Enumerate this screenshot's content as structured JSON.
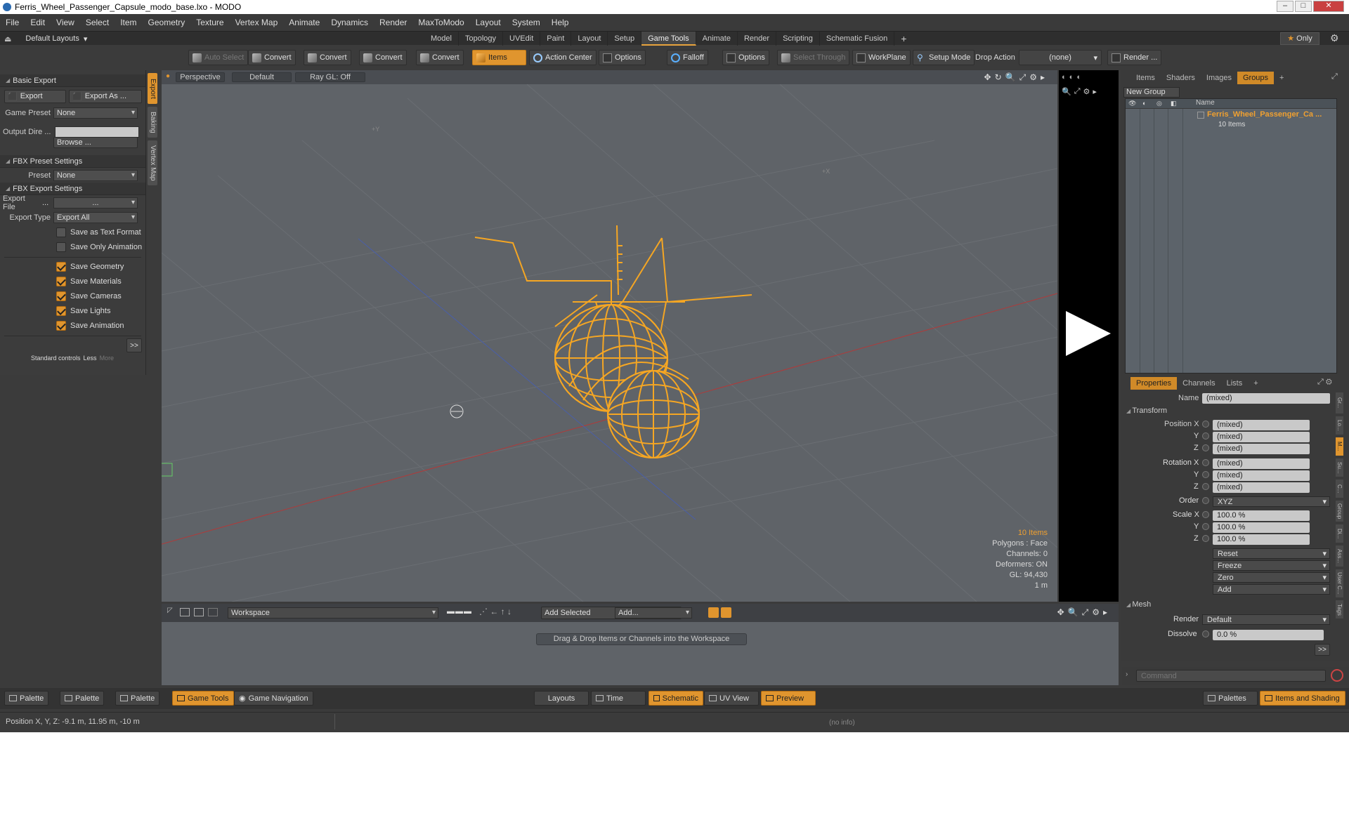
{
  "window": {
    "title": "Ferris_Wheel_Passenger_Capsule_modo_base.lxo - MODO"
  },
  "menu": [
    "File",
    "Edit",
    "View",
    "Select",
    "Item",
    "Geometry",
    "Texture",
    "Vertex Map",
    "Animate",
    "Dynamics",
    "Render",
    "MaxToModo",
    "Layout",
    "System",
    "Help"
  ],
  "layouts": {
    "selector": "Default Layouts",
    "tabs": [
      "Model",
      "Topology",
      "UVEdit",
      "Paint",
      "Layout",
      "Setup",
      "Game Tools",
      "Animate",
      "Render",
      "Scripting",
      "Schematic Fusion"
    ],
    "active_tab": "Game Tools",
    "add": "+",
    "only_label": "Only"
  },
  "toolbar": {
    "auto_select": "Auto Select",
    "convert1": "Convert",
    "convert2": "Convert",
    "convert3": "Convert",
    "convert4": "Convert",
    "items": "Items",
    "action_center": "Action Center",
    "options1": "Options",
    "falloff": "Falloff",
    "options2": "Options",
    "select_through": "Select Through",
    "workplane": "WorkPlane",
    "setup_mode": "Setup Mode",
    "drop_action_label": "Drop Action",
    "drop_action_value": "(none)",
    "render": "Render ..."
  },
  "left_panel": {
    "side_tabs": [
      "Export",
      "Baking",
      "Vertex Map"
    ],
    "basic_export": "Basic Export",
    "export_btn": "Export",
    "export_as_btn": "Export As ...",
    "game_preset_label": "Game Preset",
    "game_preset_value": "None",
    "output_dir_label": "Output Dire ...",
    "output_dir_value": "",
    "browse": "Browse ...",
    "fbx_preset_settings": "FBX Preset Settings",
    "preset_label": "Preset",
    "preset_value": "None",
    "fbx_export_settings": "FBX Export Settings",
    "export_file_label": "Export File",
    "export_file_dots": "...",
    "export_file_value": "...",
    "export_type_label": "Export Type",
    "export_type_value": "Export All",
    "checkboxes": [
      {
        "label": "Save as Text Format",
        "checked": false
      },
      {
        "label": "Save Only Animation",
        "checked": false
      },
      {
        "label": "Save Geometry",
        "checked": true
      },
      {
        "label": "Save Materials",
        "checked": true
      },
      {
        "label": "Save Cameras",
        "checked": true
      },
      {
        "label": "Save Lights",
        "checked": true
      },
      {
        "label": "Save Animation",
        "checked": true
      }
    ],
    "expand": ">>",
    "standard_controls": "Standard controls",
    "less": "Less",
    "more": "More"
  },
  "viewport": {
    "view": "Perspective",
    "shading": "Default",
    "raygl": "Ray GL: Off",
    "axis_y_marker": "+Y",
    "axis_x_marker": "+X",
    "stats": {
      "items": "10 Items",
      "polygons": "Polygons : Face",
      "channels": "Channels: 0",
      "deformers": "Deformers: ON",
      "gl": "GL: 94,430",
      "scale": "1 m"
    }
  },
  "workspace": {
    "name": "Workspace",
    "add_selected": "Add Selected",
    "add": "Add...",
    "drag_msg": "Drag & Drop Items or Channels into the Workspace"
  },
  "groups_panel": {
    "tabs": [
      "Items",
      "Shaders",
      "Images",
      "Groups"
    ],
    "active_tab": "Groups",
    "add": "+",
    "new_group": "New Group",
    "col_name": "Name",
    "item_name": "Ferris_Wheel_Passenger_Ca ...",
    "item_count": "10 Items"
  },
  "properties": {
    "tabs": [
      "Properties",
      "Channels",
      "Lists"
    ],
    "active_tab": "Properties",
    "add": "+",
    "name_label": "Name",
    "name_value": "(mixed)",
    "transform": "Transform",
    "position_label": "Position X",
    "rotation_label": "Rotation X",
    "scale_label": "Scale X",
    "y": "Y",
    "z": "Z",
    "mixed": "(mixed)",
    "order_label": "Order",
    "order_value": "XYZ",
    "scale_x": "100.0 %",
    "scale_y": "100.0 %",
    "scale_z": "100.0 %",
    "actions": [
      "Reset",
      "Freeze",
      "Zero",
      "Add"
    ],
    "mesh": "Mesh",
    "render_label": "Render",
    "render_value": "Default",
    "dissolve_label": "Dissolve",
    "dissolve_value": "0.0 %",
    "expand": ">>",
    "side_tabs": [
      "Gr...",
      "Lo...",
      "M...",
      "Su...",
      "C...",
      "Group",
      "Di...",
      "Ass...",
      "User C...",
      "Tags"
    ]
  },
  "command": {
    "placeholder": "Command"
  },
  "bottom": {
    "palette1": "Palette",
    "palette2": "Palette",
    "palette3": "Palette",
    "game_tools": "Game Tools",
    "game_navigation": "Game Navigation",
    "layouts": "Layouts",
    "time": "Time",
    "schematic": "Schematic",
    "uv_view": "UV View",
    "preview": "Preview",
    "palettes": "Palettes",
    "items_and_shading": "Items and Shading"
  },
  "status": {
    "position": "Position X, Y, Z:  -9.1 m, 11.95 m, -10 m",
    "info": "(no info)"
  },
  "colors": {
    "accent": "#e0952e",
    "wireframe": "#f5a623",
    "viewport_bg": "#5f6368"
  }
}
